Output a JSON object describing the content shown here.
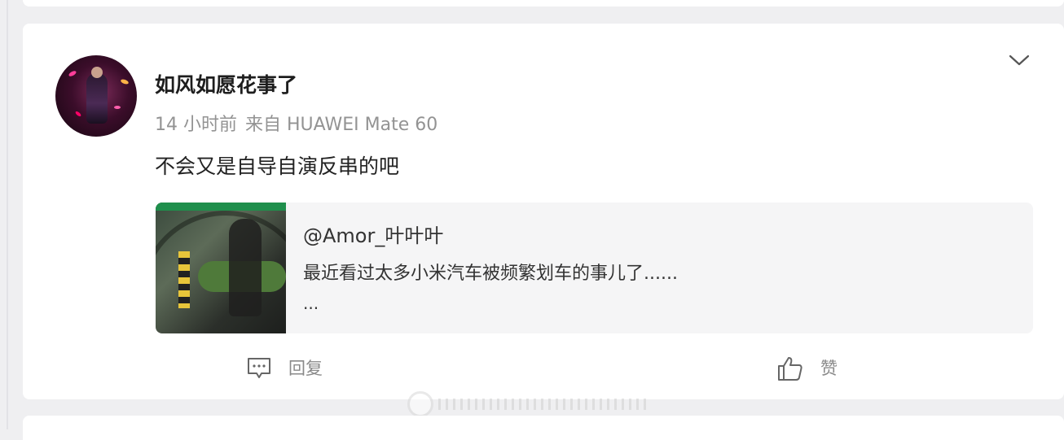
{
  "post": {
    "username": "如风如愿花事了",
    "time": "14 小时前",
    "source": "来自 HUAWEI Mate 60",
    "content": "不会又是自导自演反串的吧"
  },
  "quoted": {
    "user": "@Amor_叶叶叶",
    "text": "最近看过太多小米汽车被频繁划车的事儿了......",
    "more": "..."
  },
  "actions": {
    "reply_label": "回复",
    "like_label": "赞"
  },
  "icons": {
    "menu": "chevron-down-icon",
    "reply": "comment-icon",
    "like": "thumbs-up-icon"
  },
  "colors": {
    "background": "#efeff1",
    "card": "#ffffff",
    "meta_text": "#939393",
    "quote_bg": "#f5f5f6"
  }
}
